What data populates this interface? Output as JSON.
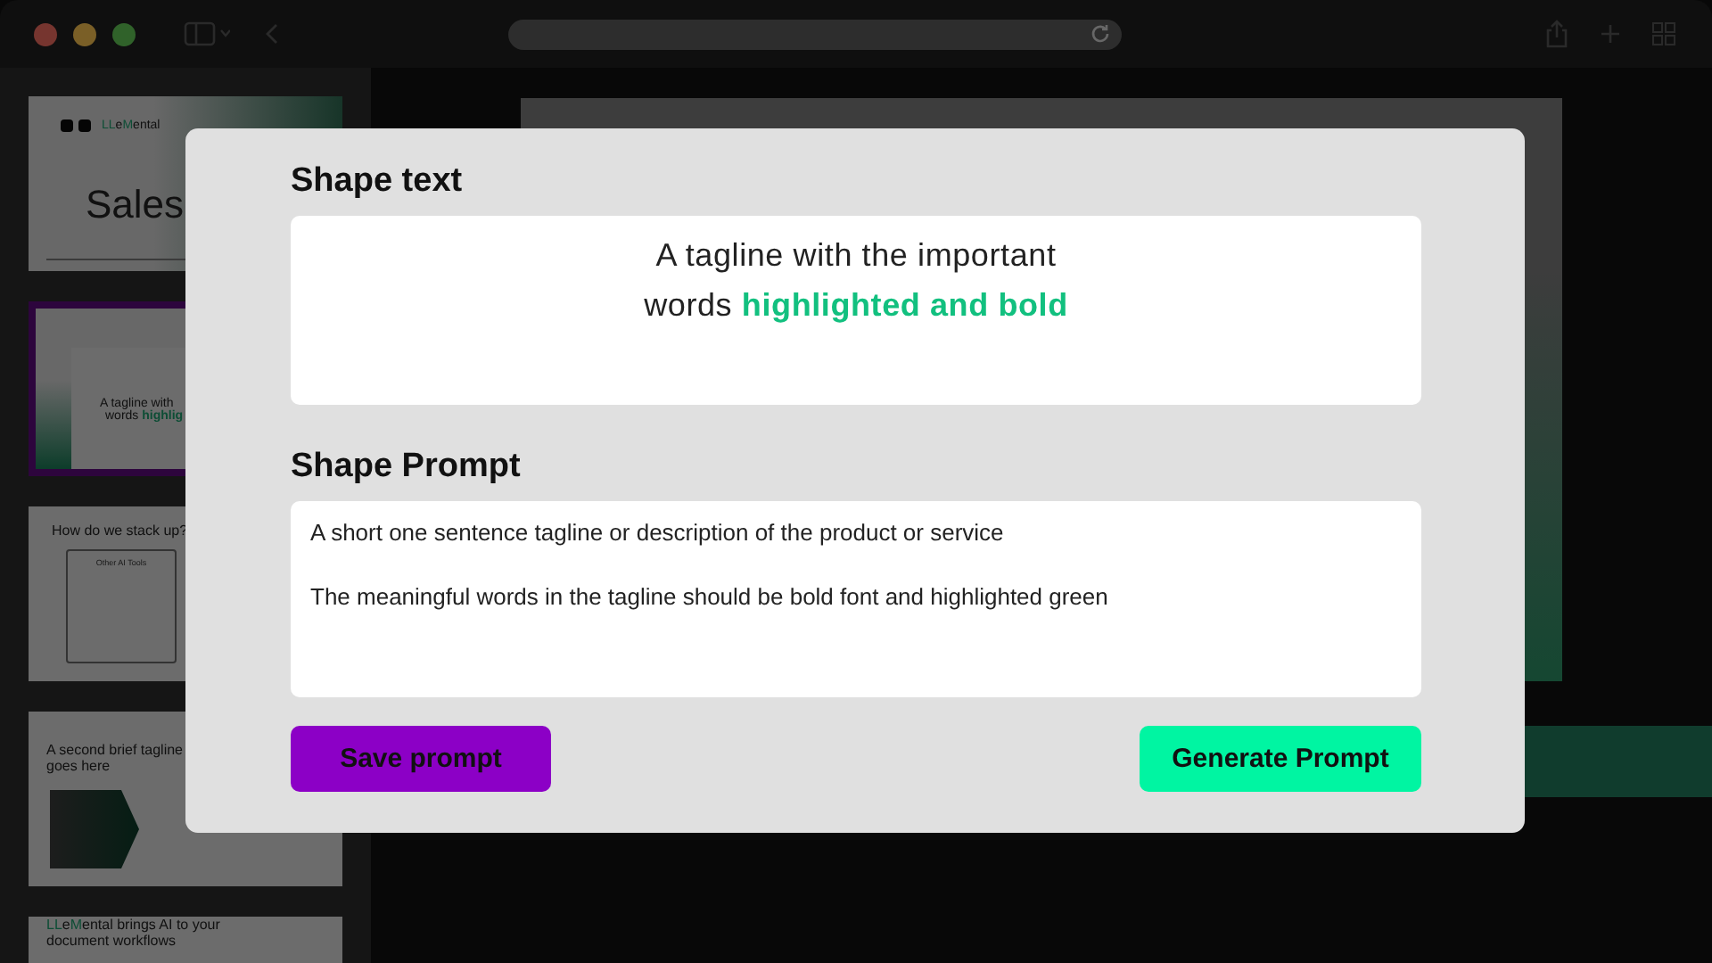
{
  "slides": [
    {
      "kind": "title",
      "selected": false,
      "logo": "**LL**e**M**ental",
      "title": "Sales"
    },
    {
      "kind": "tagline",
      "selected": true,
      "lines": [
        "A tagline with",
        "words **highlig**"
      ]
    },
    {
      "kind": "table",
      "selected": false,
      "title": "How do we stack up?",
      "card_title": "Other AI Tools"
    },
    {
      "kind": "hexagons",
      "selected": false,
      "title": "A second brief tagline goes here"
    },
    {
      "kind": "brand",
      "selected": false,
      "title": "**LL**e**M**ental brings AI to your document workflows"
    }
  ],
  "dialog": {
    "shape_text": {
      "title": "Shape text",
      "lines": [
        "A tagline with the important",
        "words **highlighted and bold**"
      ]
    },
    "shape_prompt": {
      "title": "Shape Prompt",
      "lines": [
        "A short one sentence tagline or description of the product or service",
        "The meaningful words in the tagline should be bold font and highlighted green"
      ]
    },
    "buttons": [
      {
        "kind": "save",
        "label": "Save prompt"
      },
      {
        "kind": "generate",
        "label": "Generate Prompt"
      }
    ]
  }
}
